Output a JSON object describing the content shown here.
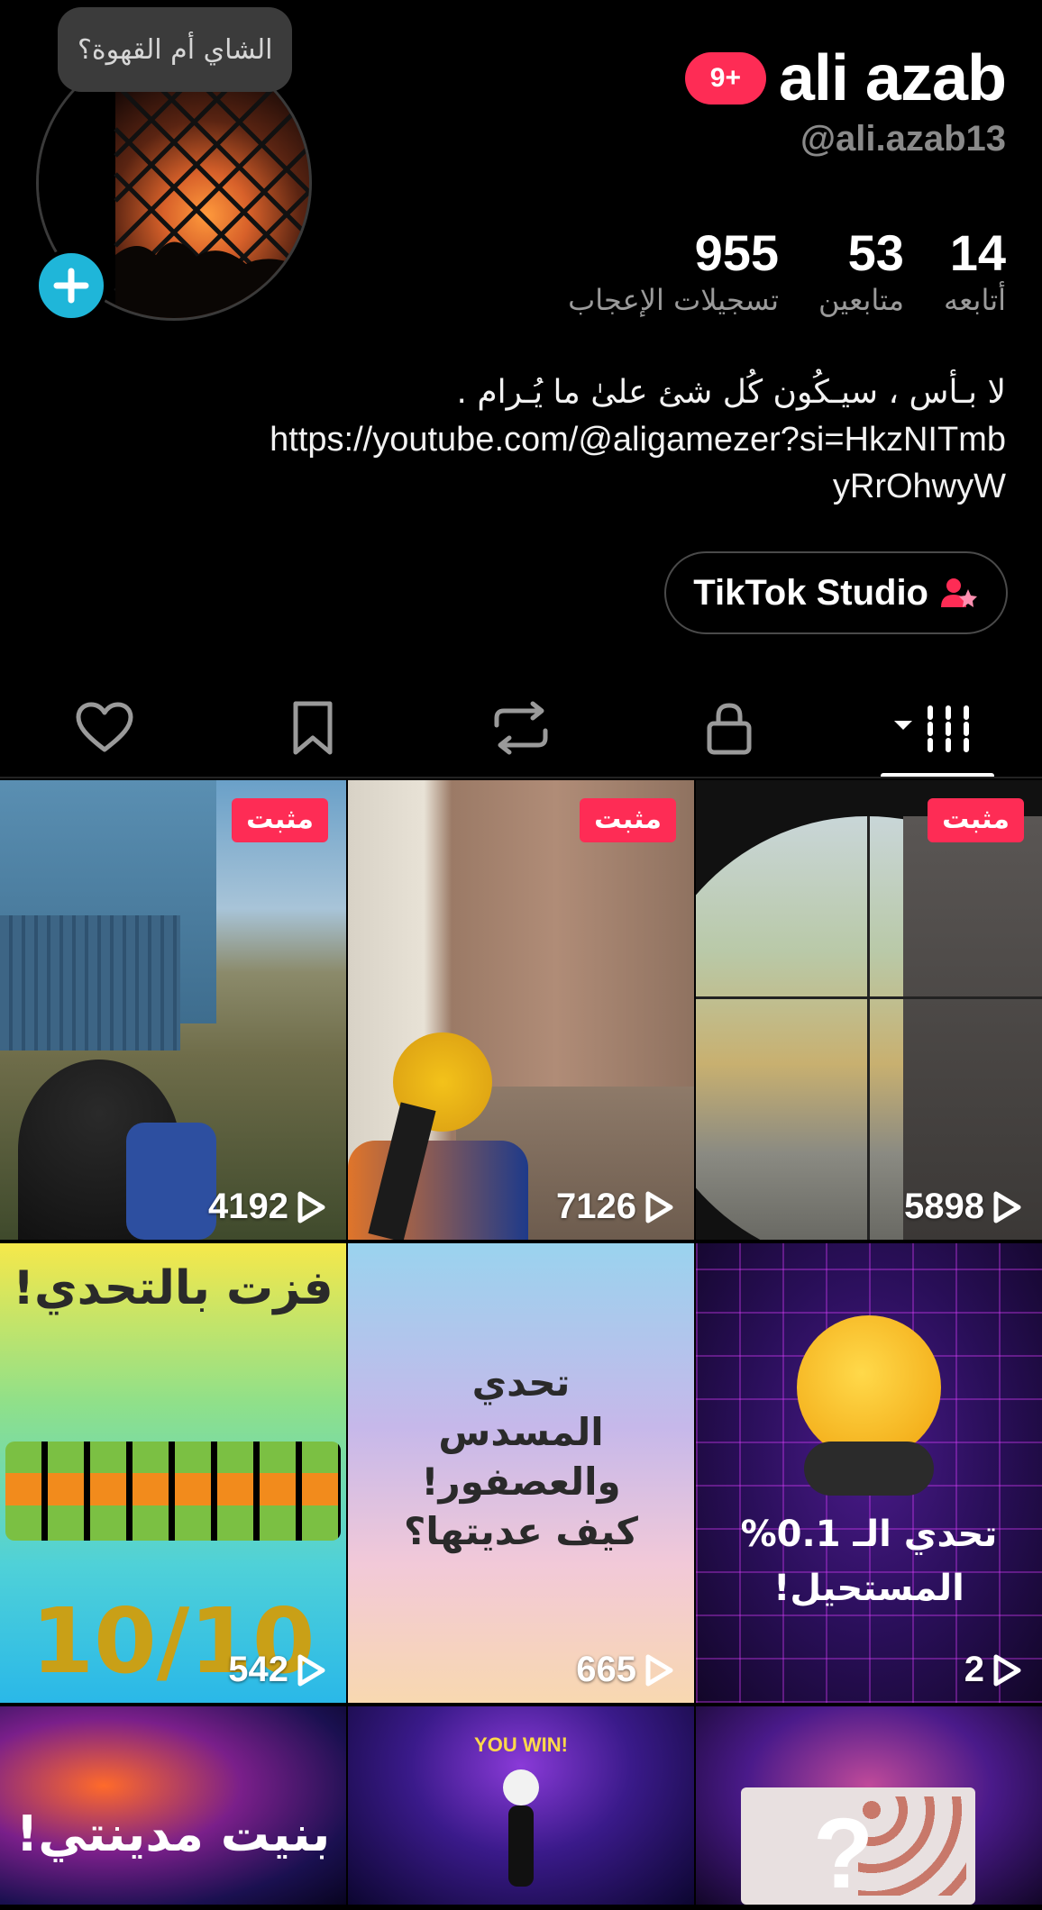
{
  "profile": {
    "note": "الشاي أم القهوة؟",
    "name": "ali azab",
    "notif_badge": "9+",
    "handle": "@ali.azab13",
    "stats": [
      {
        "value": "14",
        "label": "أتابعه"
      },
      {
        "value": "53",
        "label": "متابعين"
      },
      {
        "value": "955",
        "label": "تسجيلات الإعجاب"
      }
    ],
    "bio_line1": "لا بـأس ، سيـكُون كُل شئ علىٰ ما يُـرام .",
    "bio_link": "https://youtube.com/@aligamezer?si=HkzNITmbyRrOhwyW",
    "studio_button": "TikTok Studio"
  },
  "tabs": [
    {
      "icon": "grid-icon",
      "active": true
    },
    {
      "icon": "lock-icon",
      "active": false
    },
    {
      "icon": "repost-icon",
      "active": false
    },
    {
      "icon": "bookmark-icon",
      "active": false
    },
    {
      "icon": "heart-icon",
      "active": false
    }
  ],
  "videos": [
    {
      "pinned": "مثبت",
      "views": "4192"
    },
    {
      "pinned": "مثبت",
      "views": "7126"
    },
    {
      "pinned": "مثبت",
      "views": "5898"
    },
    {
      "views": "542",
      "overlay": [
        "فزت بالتحدي!",
        "10/10"
      ]
    },
    {
      "views": "665",
      "overlay": [
        "تحدي",
        "المسدس",
        "والعصفور!",
        "كيف عديتها؟"
      ]
    },
    {
      "views": "2",
      "overlay": [
        "تحدي الـ 0.1%",
        "المستحيل!"
      ]
    },
    {
      "overlay": [
        "بنيت مدينتي!"
      ]
    },
    {
      "overlay": [
        "YOU WIN!"
      ]
    },
    {
      "overlay": [
        "?"
      ]
    }
  ],
  "colors": {
    "accent": "#fe2c55",
    "add": "#1fb6d9"
  }
}
